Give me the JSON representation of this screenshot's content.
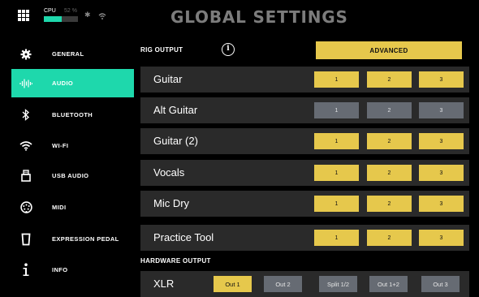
{
  "header": {
    "title": "GLOBAL SETTINGS",
    "cpu_label": "CPU",
    "cpu_value": "52 %",
    "cpu_fraction": 0.52,
    "icons": [
      "apps-grid-icon",
      "bluetooth-icon",
      "wifi-icon"
    ]
  },
  "sidebar": {
    "items": [
      {
        "label": "GENERAL",
        "icon": "gear-icon"
      },
      {
        "label": "AUDIO",
        "icon": "audio-waveform-icon"
      },
      {
        "label": "BLUETOOTH",
        "icon": "bluetooth-icon"
      },
      {
        "label": "WI-FI",
        "icon": "wifi-icon"
      },
      {
        "label": "USB AUDIO",
        "icon": "usb-icon"
      },
      {
        "label": "MIDI",
        "icon": "midi-icon"
      },
      {
        "label": "EXPRESSION PEDAL",
        "icon": "expression-pedal-icon"
      },
      {
        "label": "INFO",
        "icon": "info-icon"
      }
    ],
    "active": "AUDIO"
  },
  "rig_output": {
    "label": "RIG OUTPUT",
    "info_glyph": "i",
    "advanced_label": "ADVANCED",
    "rows": [
      {
        "name": "Guitar",
        "buttons": [
          "1",
          "2",
          "3"
        ],
        "state": "on"
      },
      {
        "name": "Alt Guitar",
        "buttons": [
          "1",
          "2",
          "3"
        ],
        "state": "off"
      },
      {
        "name": "Guitar (2)",
        "buttons": [
          "1",
          "2",
          "3"
        ],
        "state": "on"
      },
      {
        "name": "Vocals",
        "buttons": [
          "1",
          "2",
          "3"
        ],
        "state": "on"
      },
      {
        "name": "Mic Dry",
        "buttons": [
          "1",
          "2",
          "3"
        ],
        "state": "on"
      },
      {
        "name": "Practice Tool",
        "buttons": [
          "1",
          "2",
          "3"
        ],
        "state": "on"
      }
    ]
  },
  "hardware_output": {
    "label": "HARDWARE OUTPUT",
    "row": {
      "name": "XLR",
      "options": [
        "Out 1",
        "Out 2",
        "Split 1/2",
        "Out 1+2",
        "Out 3"
      ],
      "selected": "Out 1"
    }
  },
  "colors": {
    "accent": "#1ed8ac",
    "button_on": "#e6c84c",
    "button_off": "#666b73",
    "row_bg": "#2a2a2a",
    "title": "#7c7c7c"
  }
}
